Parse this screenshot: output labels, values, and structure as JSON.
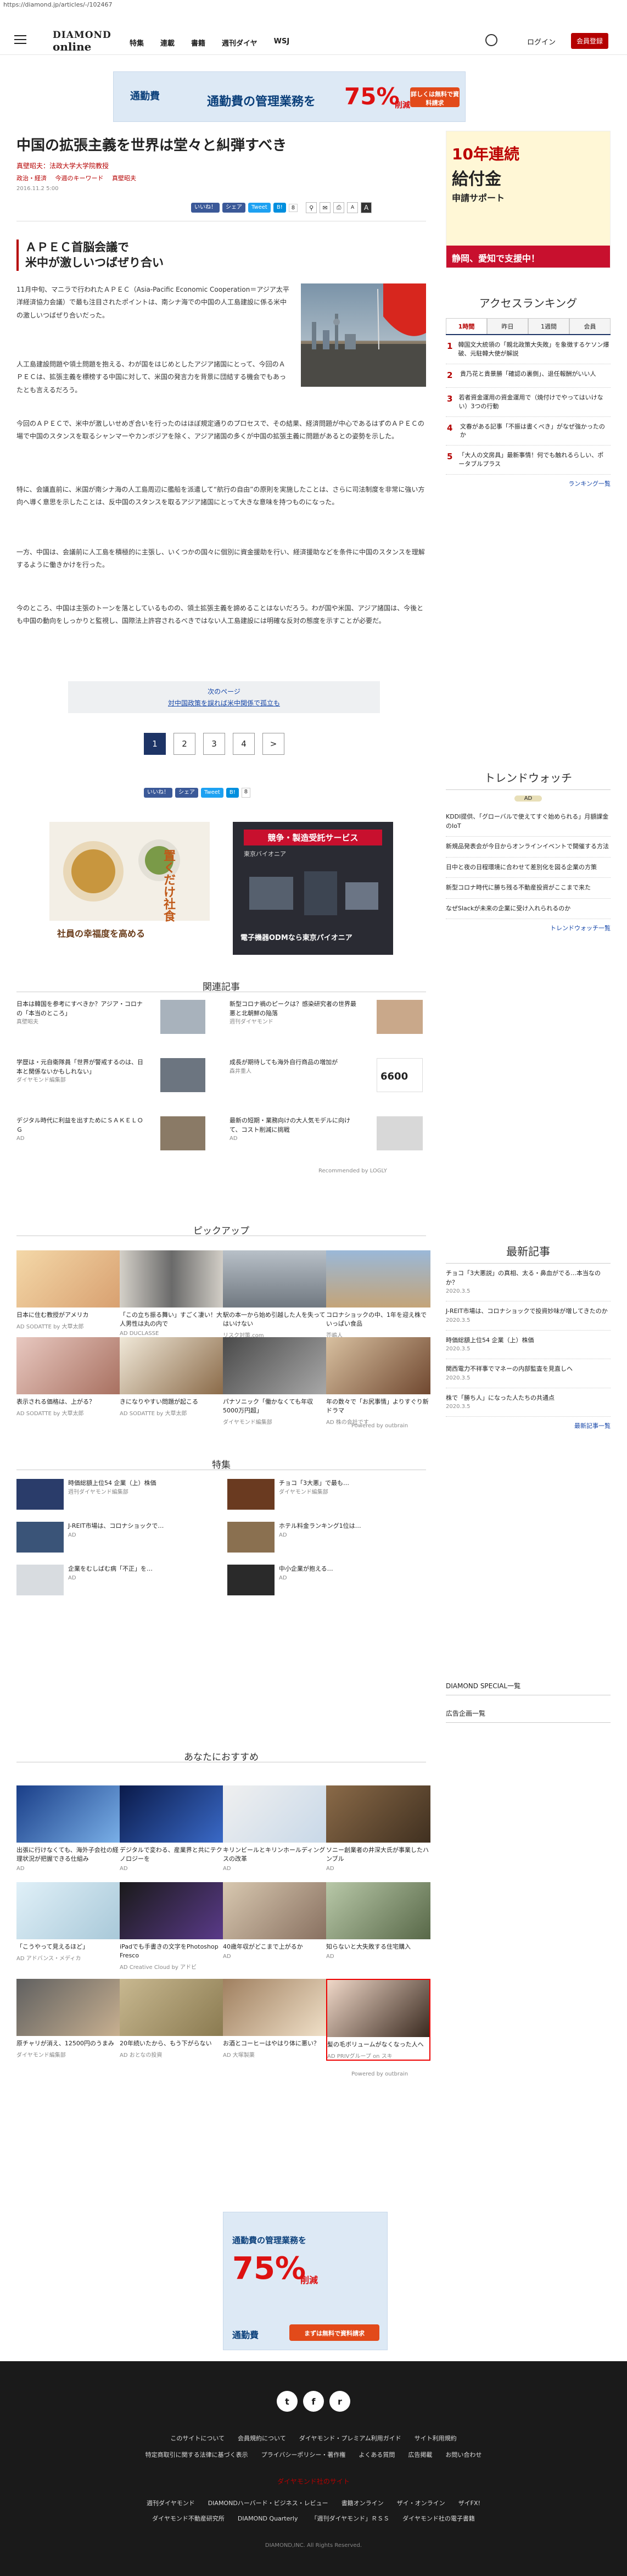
{
  "url": "https://diamond.jp/articles/-/102467",
  "header": {
    "logo1": "DIAMOND",
    "logo2": "online",
    "nav": [
      "特集",
      "連載",
      "書籍",
      "週刊ダイヤ",
      "WSJ"
    ],
    "login": "ログイン",
    "member": "会員登録"
  },
  "banner_top": {
    "brand": "通勤費",
    "text1": "通勤費の管理業務を",
    "pct": "75%",
    "suffix": "削減",
    "cta": "詳しくは無料で資料請求"
  },
  "article": {
    "title": "中国の拡張主義を世界は堂々と糾弾すべき",
    "author": "真壁昭夫：法政大学大学院教授",
    "tags": [
      "政治・経済",
      "今週のキーワード",
      "真壁昭夫"
    ],
    "date": "2016.11.2 5:00",
    "share": {
      "like": "いいね！",
      "share": "シェア",
      "tweet": "Tweet",
      "b": "B!",
      "count": "8"
    },
    "subheading": [
      "ＡＰＥＣ首脳会議で",
      "米中が激しいつばぜり合い"
    ],
    "p1": "11月中旬、マニラで行われたＡＰＥＣ（Asia-Pacific Economic Cooperation＝アジア太平洋経済協力会議）で最も注目されたポイントは、南シナ海での中国の人工島建設に係る米中の激しいつばぜり合いだった。",
    "p2": "人工島建設問題や領土問題を抱える、わが国をはじめとしたアジア諸国にとって、今回のＡＰＥＣは、拡張主義を標榜する中国に対して、米国の発言力を背景に団結する機会でもあったとも言えるだろう。",
    "p3": "今回のＡＰＥＣで、米中が激しいせめぎ合いを行ったのはほぼ規定通りのプロセスで、その結果、経済問題が中心であるはずのＡＰＥＣの場で中国のスタンスを取るシャンマーやカンボジアを除く、アジア諸国の多くが中国の拡張主義に問題があるとの姿勢を示した。",
    "p4": "特に、会議直前に、米国が南シナ海の人工島周辺に艦船を派遣して“航行の自由”の原則を実施したことは、さらに司法制度を非常に強い方向へ導く意思を示したことは、反中国のスタンスを取るアジア諸国にとって大きな意味を持つものになった。",
    "p5": "一方、中国は、会議前に人工島を積極的に主張し、いくつかの国々に個別に資金援助を行い、経済援助などを条件に中国のスタンスを理解するように働きかけを行った。",
    "p6": "今のところ、中国は主張のトーンを落としているものの、領土拡張主義を諦めることはないだろう。わが国や米国、アジア諸国は、今後とも中国の動向をしっかりと監視し、国際法上許容されるべきではない人工島建設には明確な反対の態度を示すことが必要だ。",
    "next_label": "次のページ",
    "next_link": "対中国政策を誤れば米中関係で孤立も",
    "pages": [
      "1",
      "2",
      "3",
      "4",
      ">"
    ]
  },
  "ads_mid": [
    {
      "line1": "社員の幸福度を高める",
      "line2": "置くだけ社食"
    },
    {
      "badge": "競争・製造受託サービス",
      "sub": "東京バイオニア",
      "line": "電子機器ODMなら東京パイオニア"
    }
  ],
  "related": {
    "title": "関連記事",
    "items": [
      {
        "t": "日本は韓国を参考にすべきか？アジア・コロナの「本当のところ」",
        "s": "真壁昭夫"
      },
      {
        "t": "新型コロナ禍のピークは？感染研究者の世界最悪と北朝鮮の陥落",
        "s": "週刊ダイヤモンド"
      },
      {
        "t": "学歴は・元自衛隊員「世界が警戒するのは、日本と関係ないかもしれない」",
        "s": "ダイヤモンド編集部"
      },
      {
        "t": "成長が期待しても海外自行商品の増加が",
        "s": "森井重人"
      },
      {
        "t": "デジタル時代に利益を出すためにＳＡＫＥＬＯＧ",
        "s": "AD"
      },
      {
        "t": "最新の短期・業務向けの大人気モデルに向けて、コスト削減に挑戦",
        "s": "AD"
      }
    ],
    "price": "6600",
    "recommended": "Recommended by LOGLY"
  },
  "pickup": {
    "title": "ピックアップ",
    "items": [
      {
        "t": "日本に住む教授がアメリカ",
        "s": "AD SODATTE by 大草太郎"
      },
      {
        "t": "「この立ち振る舞い」すごく凄い！大人男性は丸の内で",
        "s": "AD DUCLASSE"
      },
      {
        "t": "駅の本一から始め引越した人を失ってはいけない",
        "s": "リスク対策.com"
      },
      {
        "t": "コロナショックの中、1年を迎え株でいっぱい食品",
        "s": "芥嶋人"
      },
      {
        "t": "表示される価格は、上がる？",
        "s": "AD SODATTE by 大草太郎"
      },
      {
        "t": "きになりやすい問題が起こる",
        "s": "AD SODATTE by 大草太郎"
      },
      {
        "t": "パナソニック「働かなくても年収5000万円超」",
        "s": "ダイヤモンド編集部"
      },
      {
        "t": "年の数々で「お尻事情」よりすぐり新ドラマ",
        "s": "AD 株の会社です"
      }
    ],
    "powered": "Powered by outbrain"
  },
  "features": {
    "title": "特集",
    "items": [
      {
        "t": "時価総額上位54 企業（上）株価",
        "s": "週刊ダイヤモンド編集部"
      },
      {
        "t": "チョコ「3大悪」で最も…",
        "s": "ダイヤモンド編集部"
      },
      {
        "t": "J-REIT市場は、コロナショックで…",
        "s": "AD"
      },
      {
        "t": "ホテル料金ランキング1位は…",
        "s": "AD"
      },
      {
        "t": "企業をむしばむ病「不正」を…",
        "s": "AD"
      },
      {
        "t": "中小企業が抱える…",
        "s": "AD"
      }
    ]
  },
  "recommend": {
    "title": "あなたにおすすめ",
    "items": [
      {
        "t": "出張に行けなくても、海外子会社の経理状況が把握できる仕組み",
        "s": "AD"
      },
      {
        "t": "デジタルで変わる、産業界と共にテクノロジーを",
        "s": "AD"
      },
      {
        "t": "キリンビールとキリンホールディングスの改革",
        "s": "AD"
      },
      {
        "t": "ソニー創業者の井深大氏が事業したハンブル",
        "s": "AD"
      },
      {
        "t": "「こうやって見えるほど」",
        "s": "AD アドバンス・メディカ"
      },
      {
        "t": "iPadでも手書きの文字をPhotoshop Fresco",
        "s": "AD Creative Cloud by アドビ"
      },
      {
        "t": "40歳年収がどこまで上がるか",
        "s": "AD"
      },
      {
        "t": "知らないと大失敗する住宅購入",
        "s": "AD"
      },
      {
        "t": "原チャリが消え、12500円のうまみ",
        "s": "ダイヤモンド編集部"
      },
      {
        "t": "20年続いたから、もう下がらない",
        "s": "AD おとなの投資"
      },
      {
        "t": "お酒とコーヒーはやはり体に悪い？",
        "s": "AD 大塚製薬"
      },
      {
        "t": "髪の毛ボリュームがなくなった人へ",
        "s": "AD PRIVグループ on スキ"
      }
    ],
    "powered": "Powered by outbrain"
  },
  "banner_bottom": {
    "brand": "通勤費",
    "text1": "通勤費の管理業務を",
    "pct": "75%",
    "suffix": "削減",
    "cta": "まずは無料で資料請求"
  },
  "sidebar": {
    "ad_top": {
      "l1": "10年連続",
      "l2": "給付金",
      "l3": "申請サポート",
      "red": "静岡、愛知で支援中！"
    },
    "ranking_title": "アクセスランキング",
    "tabs": [
      "1時間",
      "昨日",
      "1週間",
      "会員"
    ],
    "ranking": [
      "韓国文大統領の「親北政策大失敗」を象徴するケソン爆破、元駐韓大使が解説",
      "貴乃花と貴景勝「確認の裏側」、退任報酬がいい人",
      "若者資金運用の資金運用で（焼付けでやってはいけない）3つの行動",
      "文春がある記事「不振は書くべき」がなぜ強かったのか",
      "「大人の文房具」最新事情！何でも触れるらしい、ポータブルプラス"
    ],
    "more": "ランキング一覧",
    "trend_title": "トレンドウォッチ",
    "trend_ad": "AD",
    "trends": [
      "KDDI提供、「グローバルで使えてすぐ始められる」月額課金のIoT",
      "新規品発表会が今日からオンラインイベントで開催する方法",
      "日中と夜の日程環境に合わせて差別化を図る企業の方策",
      "新型コロナ時代に勝ち残る不動産投資がここまで来た",
      "なぜSlackが未来の企業に受け入れられるのか"
    ],
    "trend_more": "トレンドウォッチ一覧",
    "latest_title": "最新記事",
    "latest": [
      {
        "t": "チョコ「3大悪説」の真相、太る・鼻血がでる…本当なのか？",
        "d": "2020.3.5"
      },
      {
        "t": "J-REIT市場は、コロナショックで投資妙味が増してきたのか",
        "d": "2020.3.5"
      },
      {
        "t": "時価総額上位54 企業（上）株価",
        "d": "2020.3.5"
      },
      {
        "t": "関西電力不祥事でマネーの内部監査を見直しへ",
        "d": "2020.3.5"
      },
      {
        "t": "株で「勝ち人」になった人たちの共通点",
        "d": "2020.3.5"
      }
    ],
    "latest_more": "最新記事一覧",
    "special": "DIAMOND SPECIAL一覧",
    "adlist": "広告企画一覧"
  },
  "footer": {
    "social": [
      "t",
      "f",
      "r"
    ],
    "row1": [
      "このサイトについて",
      "会員規約について",
      "ダイヤモンド・プレミアム利用ガイド",
      "サイト利用規約"
    ],
    "row2": [
      "特定商取引に関する法律に基づく表示",
      "プライバシーポリシー・著作権",
      "よくある質問",
      "広告掲載",
      "お問い合わせ"
    ],
    "sites_title": "ダイヤモンド社のサイト",
    "row3": [
      "週刊ダイヤモンド",
      "DIAMONDハーバード・ビジネス・レビュー",
      "書籍オンライン",
      "ザイ・オンライン",
      "ザイFX!"
    ],
    "row4": [
      "ダイヤモンド不動産研究所",
      "DIAMOND Quarterly",
      "「週刊ダイヤモンド」ＲＳＳ",
      "ダイヤモンド社の電子書籍"
    ],
    "copyright": "DIAMOND,INC. All Rights Reserved."
  },
  "colors": {
    "brand_red": "#b50000",
    "navy": "#1d3466",
    "link": "#1646a8"
  }
}
